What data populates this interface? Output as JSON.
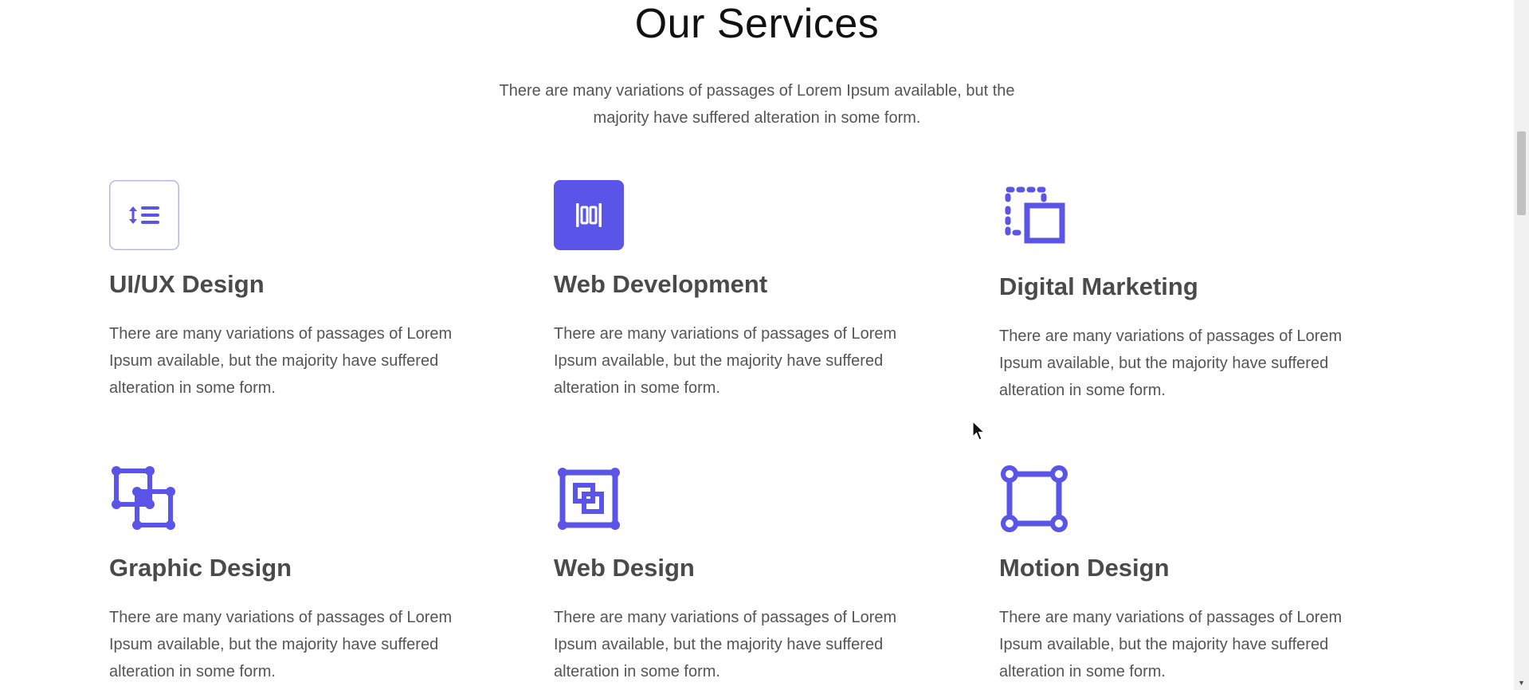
{
  "section": {
    "title": "Our Services",
    "subtitle": "There are many variations of passages of Lorem Ipsum available, but the majority have suffered alteration in some form."
  },
  "colors": {
    "accent": "#5b54e8",
    "heading": "#4a4a4a",
    "body_text": "#555555"
  },
  "services": [
    {
      "title": "UI/UX Design",
      "icon": "line-height-icon",
      "description": "There are many variations of passages of Lorem Ipsum available, but the majority have suffered alteration in some form."
    },
    {
      "title": "Web Development",
      "icon": "align-distribute-icon",
      "description": "There are many variations of passages of Lorem Ipsum available, but the majority have suffered alteration in some form."
    },
    {
      "title": "Digital Marketing",
      "icon": "dashed-square-icon",
      "description": "There are many variations of passages of Lorem Ipsum available, but the majority have suffered alteration in some form."
    },
    {
      "title": "Graphic Design",
      "icon": "overlapping-frames-icon",
      "description": "There are many variations of passages of Lorem Ipsum available, but the majority have suffered alteration in some form."
    },
    {
      "title": "Web Design",
      "icon": "nested-squares-icon",
      "description": "There are many variations of passages of Lorem Ipsum available, but the majority have suffered alteration in some form."
    },
    {
      "title": "Motion Design",
      "icon": "vector-square-icon",
      "description": "There are many variations of passages of Lorem Ipsum available, but the majority have suffered alteration in some form."
    }
  ]
}
